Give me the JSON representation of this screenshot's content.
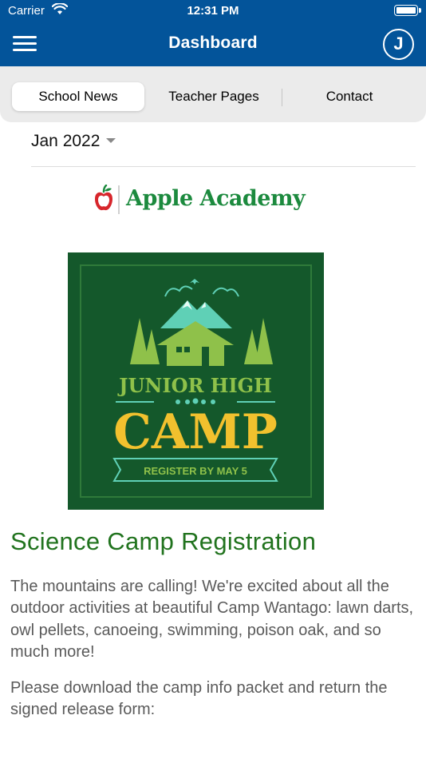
{
  "status_bar": {
    "carrier": "Carrier",
    "time": "12:31 PM"
  },
  "header": {
    "title": "Dashboard",
    "avatar_initial": "J"
  },
  "tabs": [
    {
      "label": "School News",
      "active": true
    },
    {
      "label": "Teacher Pages",
      "active": false
    },
    {
      "label": "Contact",
      "active": false
    }
  ],
  "filter": {
    "month": "Jan 2022"
  },
  "school": {
    "name": "Apple Academy"
  },
  "promo": {
    "line1": "JUNIOR HIGH",
    "line2": "CAMP",
    "banner": "REGISTER BY MAY 5"
  },
  "article": {
    "title": "Science Camp Registration",
    "paragraphs": [
      "The mountains are calling! We're excited about all the outdoor activities at beautiful Camp Wantago: lawn darts, owl pellets, canoeing, swimming, poison oak, and so much more!",
      "Please download the camp info packet and return the signed release form:"
    ]
  },
  "colors": {
    "header_bg": "#03549a",
    "brand_green": "#1c8a3e",
    "title_green": "#21731e",
    "poster_bg": "#14582b",
    "poster_yellow": "#f2c12e",
    "poster_light_green": "#8fc14a"
  },
  "icons": [
    "menu-icon",
    "wifi-icon",
    "battery-icon",
    "apple-icon",
    "dropdown-caret-icon"
  ]
}
